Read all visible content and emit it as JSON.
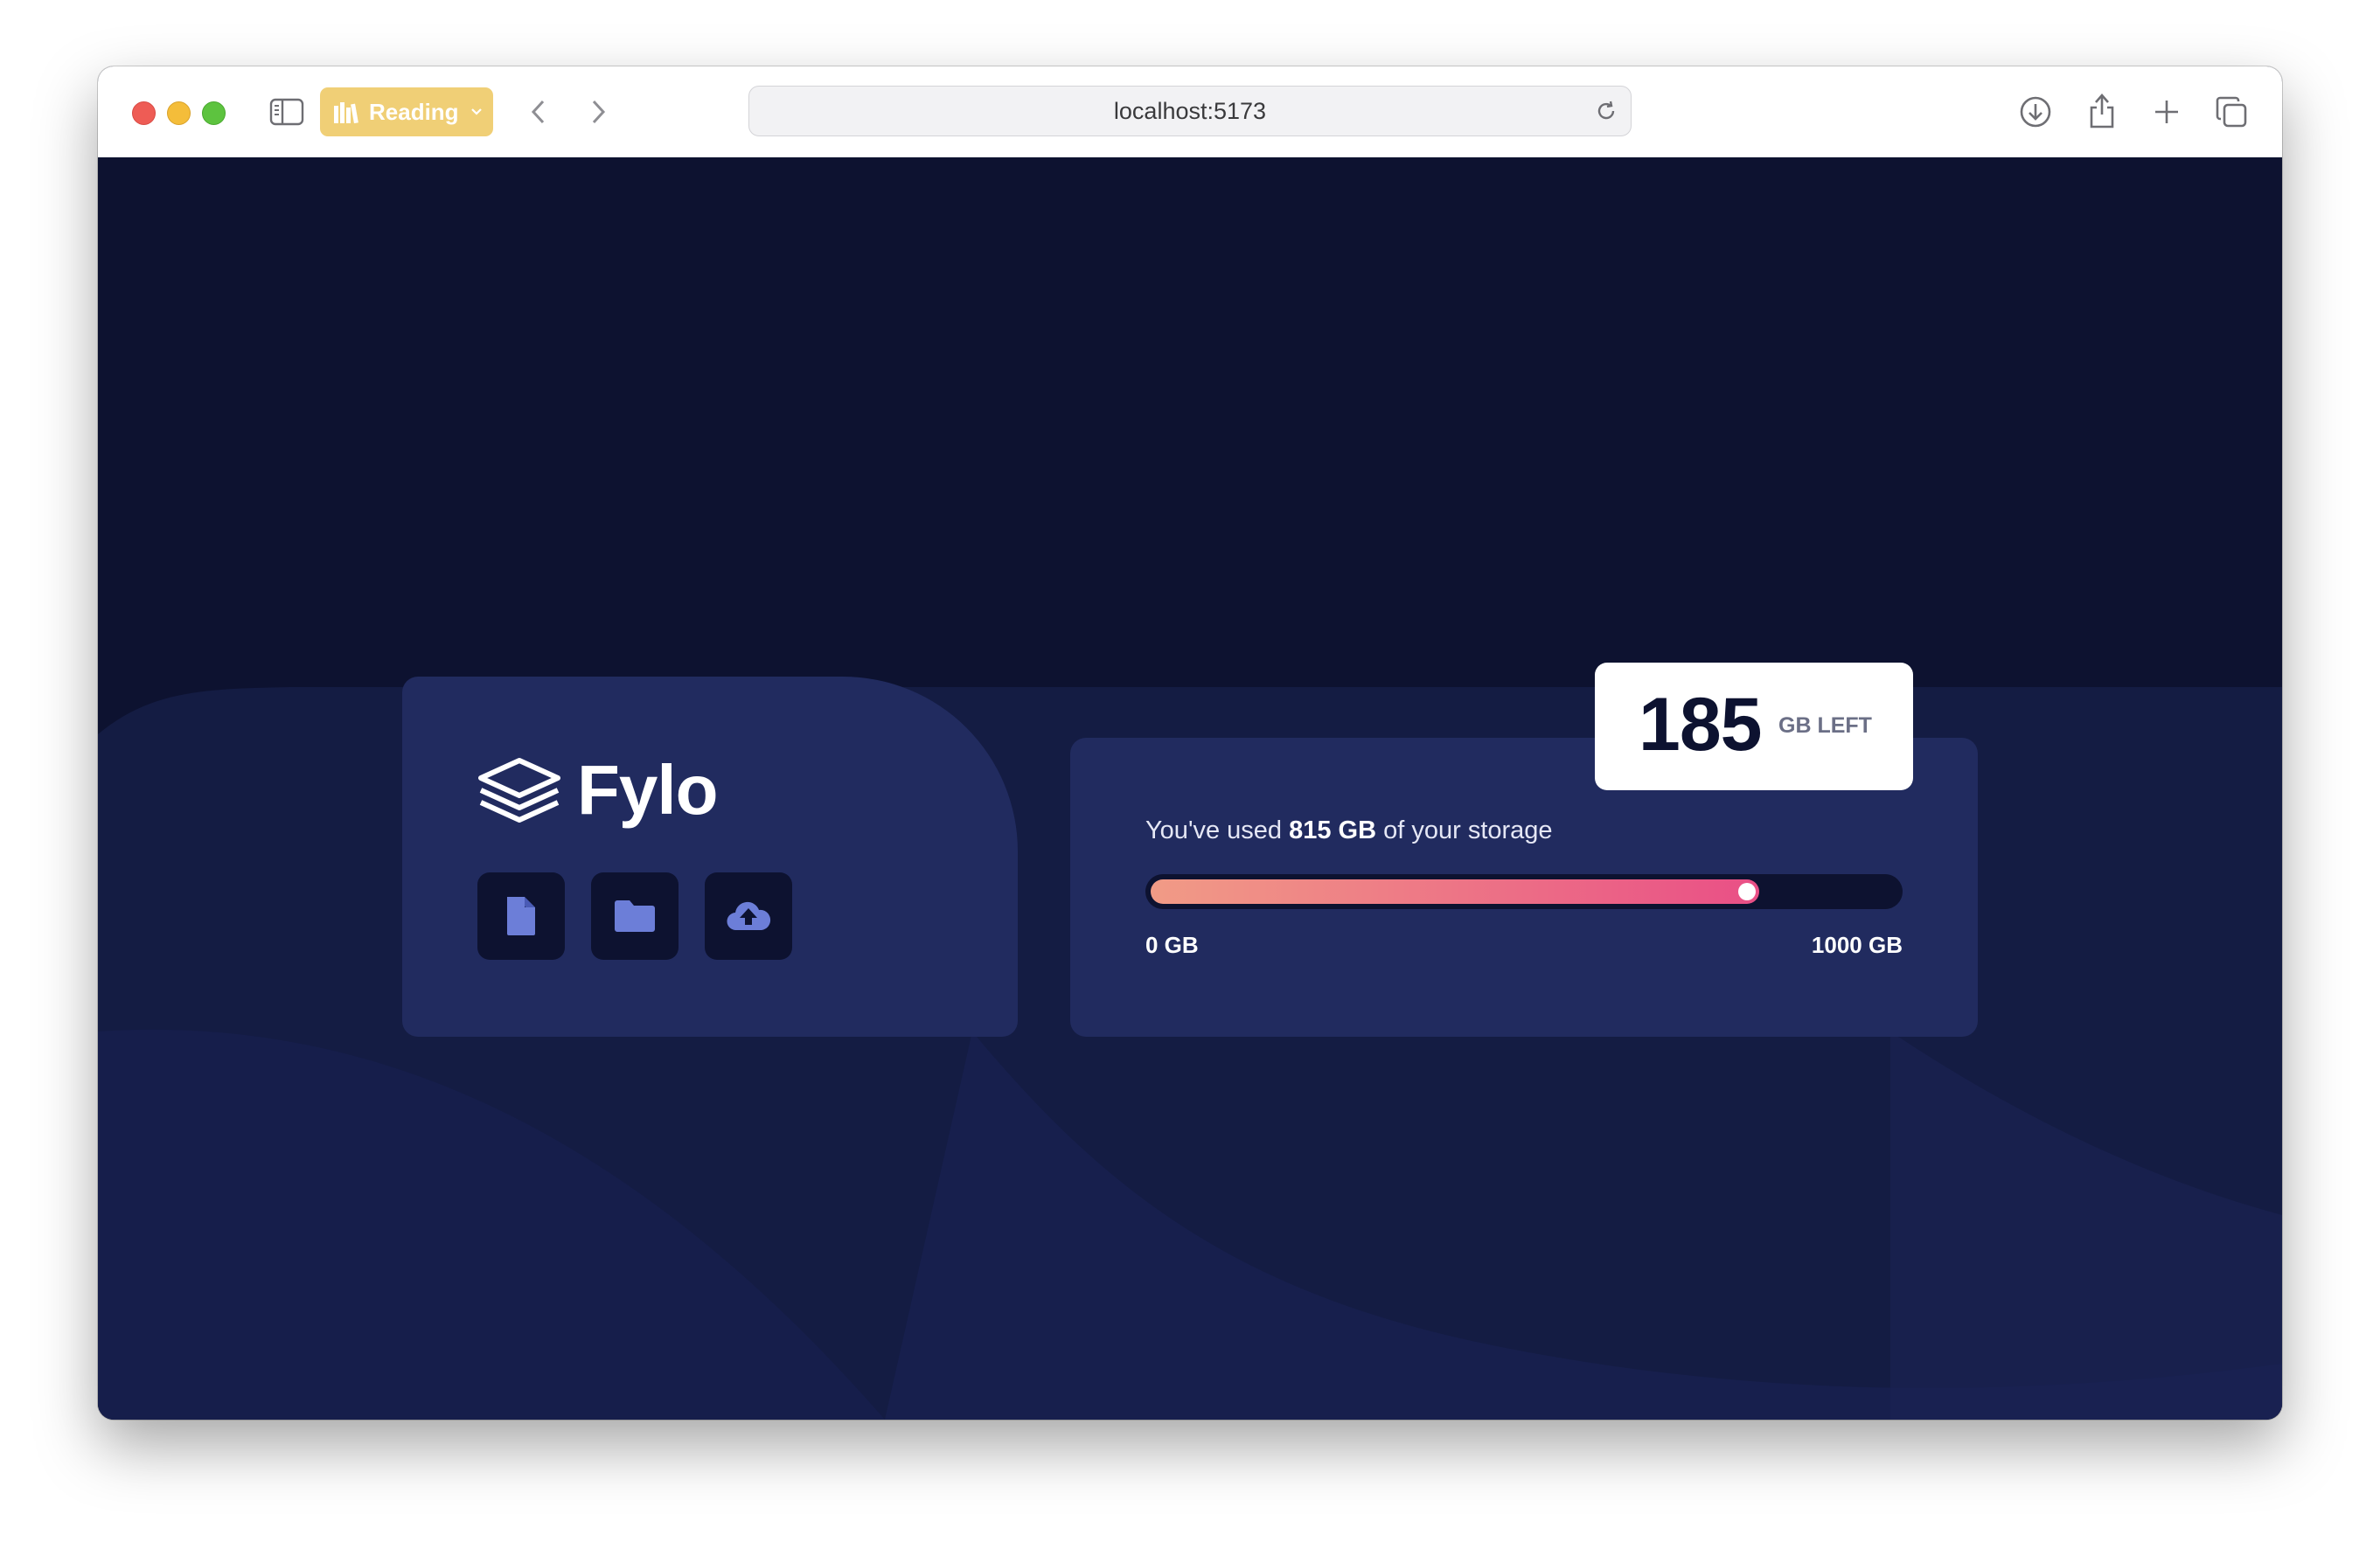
{
  "browser": {
    "reading_label": "Reading",
    "url": "localhost:5173"
  },
  "app": {
    "brand_name": "Fylo",
    "file_icons": [
      "document-icon",
      "folder-icon",
      "upload-icon"
    ],
    "storage": {
      "used_prefix": "You've used ",
      "used_amount": "815 GB",
      "used_suffix": " of your storage",
      "range_min": "0 GB",
      "range_max": "1000 GB",
      "remaining_number": "185",
      "remaining_unit": "GB LEFT",
      "used_fraction": 0.815
    }
  },
  "colors": {
    "background": "#0d1230",
    "card": "#212b5f",
    "accent_start": "#f19b86",
    "accent_end": "#e94f86",
    "icon": "#6c7ed8",
    "reading_badge": "#f0cf76"
  }
}
